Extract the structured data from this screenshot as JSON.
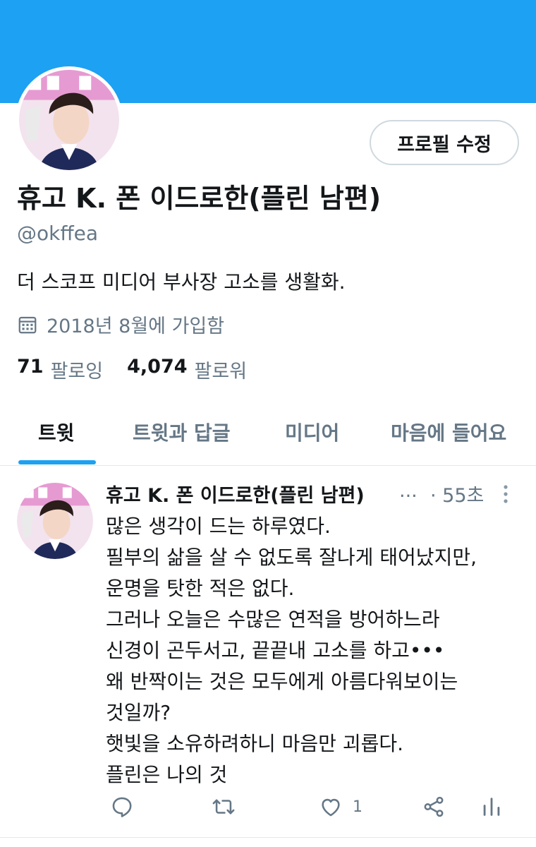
{
  "profile": {
    "edit_label": "프로필 수정",
    "display_name": "휴고 K. 폰 이드로한(플린 남편)",
    "handle": "@okffea",
    "bio": "더 스코프 미디어 부사장 고소를 생활화.",
    "joined": "2018년 8월에 가입함",
    "following_count": "71",
    "following_label": "팔로잉",
    "followers_count": "4,074",
    "followers_label": "팔로워"
  },
  "tabs": [
    {
      "label": "트윗"
    },
    {
      "label": "트윗과 답글"
    },
    {
      "label": "미디어"
    },
    {
      "label": "마음에 들어요"
    }
  ],
  "tweet": {
    "name": "휴고 K. 폰 이드로한(플린 남편)",
    "ellipsis": "...",
    "time": "· 55초",
    "lines": [
      "많은 생각이 드는 하루였다.",
      "필부의 삶을 살 수 없도록 잘나게 태어났지만,",
      "운명을 탓한 적은 없다.",
      "그러나 오늘은  수많은 연적을 방어하느라",
      "신경이 곤두서고, 끝끝내 고소를 하고•••",
      "왜 반짝이는 것은 모두에게 아름다워보이는",
      "것일까?",
      "햇빛을 소유하려하니 마음만 괴롭다.",
      "플린은 나의 것"
    ],
    "like_count": "1"
  },
  "colors": {
    "accent": "#1da1f2",
    "muted": "#657786",
    "text": "#14171a",
    "border": "#e1e8ed"
  },
  "icons": {
    "calendar": "calendar-icon",
    "reply": "reply-icon",
    "retweet": "retweet-icon",
    "like": "heart-icon",
    "share": "share-icon",
    "analytics": "analytics-icon",
    "more": "more-vertical-icon"
  }
}
